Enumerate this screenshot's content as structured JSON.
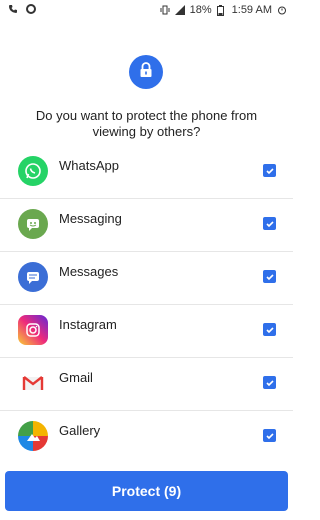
{
  "status": {
    "battery": "18%",
    "time": "1:59 AM"
  },
  "question": "Do you want to protect the phone from viewing by others?",
  "apps": [
    {
      "label": "WhatsApp",
      "icon": "whatsapp-icon",
      "color": "#25d366",
      "checked": true
    },
    {
      "label": "Messaging",
      "icon": "messaging-icon",
      "color": "#6aa84f",
      "checked": true
    },
    {
      "label": "Messages",
      "icon": "messages-icon",
      "color": "#3b6ed6",
      "checked": true
    },
    {
      "label": "Instagram",
      "icon": "instagram-icon",
      "color": "#d6249f",
      "checked": true
    },
    {
      "label": "Gmail",
      "icon": "gmail-icon",
      "color": "#e53935",
      "checked": true
    },
    {
      "label": "Gallery",
      "icon": "gallery-icon",
      "color": "#f4b400",
      "checked": true
    }
  ],
  "protect_button": "Protect (9)",
  "colors": {
    "accent": "#2f6fea"
  }
}
